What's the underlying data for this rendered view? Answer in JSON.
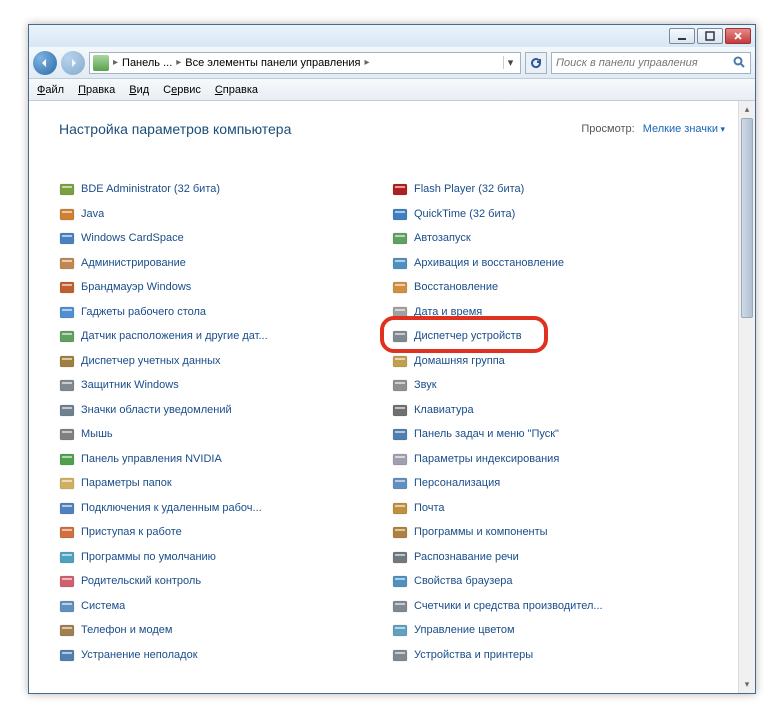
{
  "titlebar": {},
  "breadcrumb": {
    "parts": [
      "Панель ...",
      "Все элементы панели управления"
    ]
  },
  "search": {
    "placeholder": "Поиск в панели управления"
  },
  "menu": {
    "file": "Файл",
    "edit": "Правка",
    "view": "Вид",
    "service": "Сервис",
    "help": "Справка"
  },
  "header": {
    "title": "Настройка параметров компьютера",
    "view_label": "Просмотр:",
    "view_value": "Мелкие значки"
  },
  "columns": {
    "left": [
      {
        "n": "bde-administrator",
        "label": "BDE Administrator (32 бита)",
        "c": "#7aa040"
      },
      {
        "n": "java",
        "label": "Java",
        "c": "#d08030"
      },
      {
        "n": "windows-cardspace",
        "label": "Windows CardSpace",
        "c": "#4a80c0"
      },
      {
        "n": "administration",
        "label": "Администрирование",
        "c": "#c08850"
      },
      {
        "n": "windows-firewall",
        "label": "Брандмауэр Windows",
        "c": "#c06030"
      },
      {
        "n": "desktop-gadgets",
        "label": "Гаджеты рабочего стола",
        "c": "#5090d0"
      },
      {
        "n": "location-sensor",
        "label": "Датчик расположения и другие дат...",
        "c": "#60a060"
      },
      {
        "n": "credential-manager",
        "label": "Диспетчер учетных данных",
        "c": "#a08040"
      },
      {
        "n": "windows-defender",
        "label": "Защитник Windows",
        "c": "#808890"
      },
      {
        "n": "notification-icons",
        "label": "Значки области уведомлений",
        "c": "#708090"
      },
      {
        "n": "mouse",
        "label": "Мышь",
        "c": "#808080"
      },
      {
        "n": "nvidia-panel",
        "label": "Панель управления NVIDIA",
        "c": "#50a050"
      },
      {
        "n": "folder-options",
        "label": "Параметры папок",
        "c": "#d0b060"
      },
      {
        "n": "remote-desktop",
        "label": "Подключения к удаленным рабоч...",
        "c": "#5080c0"
      },
      {
        "n": "getting-started",
        "label": "Приступая к работе",
        "c": "#d07040"
      },
      {
        "n": "default-programs",
        "label": "Программы по умолчанию",
        "c": "#50a0c0"
      },
      {
        "n": "parental-controls",
        "label": "Родительский контроль",
        "c": "#d06070"
      },
      {
        "n": "system",
        "label": "Система",
        "c": "#6090c0"
      },
      {
        "n": "phone-modem",
        "label": "Телефон и модем",
        "c": "#a08050"
      },
      {
        "n": "troubleshooting",
        "label": "Устранение неполадок",
        "c": "#5080b0"
      }
    ],
    "right": [
      {
        "n": "flash-player",
        "label": "Flash Player (32 бита)",
        "c": "#b02020"
      },
      {
        "n": "quicktime",
        "label": "QuickTime (32 бита)",
        "c": "#4080c0"
      },
      {
        "n": "autorun",
        "label": "Автозапуск",
        "c": "#60a060"
      },
      {
        "n": "backup-restore",
        "label": "Архивация и восстановление",
        "c": "#5090c0"
      },
      {
        "n": "recovery",
        "label": "Восстановление",
        "c": "#d09040"
      },
      {
        "n": "date-time",
        "label": "Дата и время",
        "c": "#a0a0a0"
      },
      {
        "n": "device-manager",
        "label": "Диспетчер устройств",
        "c": "#808890"
      },
      {
        "n": "homegroup",
        "label": "Домашняя группа",
        "c": "#c0a050"
      },
      {
        "n": "sound",
        "label": "Звук",
        "c": "#909090"
      },
      {
        "n": "keyboard",
        "label": "Клавиатура",
        "c": "#707070"
      },
      {
        "n": "taskbar-start",
        "label": "Панель задач и меню \"Пуск\"",
        "c": "#5080b0"
      },
      {
        "n": "indexing-options",
        "label": "Параметры индексирования",
        "c": "#a0a0b0"
      },
      {
        "n": "personalization",
        "label": "Персонализация",
        "c": "#6090c0"
      },
      {
        "n": "mail",
        "label": "Почта",
        "c": "#c09040"
      },
      {
        "n": "programs-features",
        "label": "Программы и компоненты",
        "c": "#b08040"
      },
      {
        "n": "speech-recognition",
        "label": "Распознавание речи",
        "c": "#707880"
      },
      {
        "n": "browser-properties",
        "label": "Свойства браузера",
        "c": "#5090c0"
      },
      {
        "n": "performance-counters",
        "label": "Счетчики и средства производител...",
        "c": "#808890"
      },
      {
        "n": "color-management",
        "label": "Управление цветом",
        "c": "#60a0c0"
      },
      {
        "n": "devices-printers",
        "label": "Устройства и принтеры",
        "c": "#808890"
      }
    ]
  },
  "highlight_target": "device-manager"
}
